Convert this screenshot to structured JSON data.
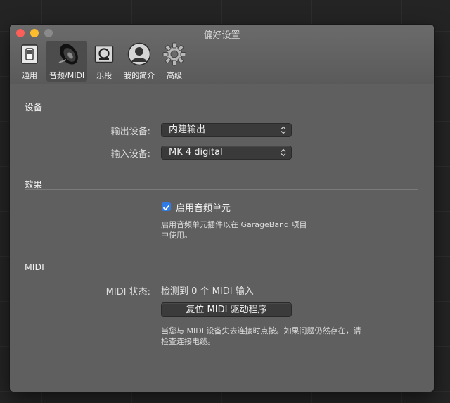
{
  "window": {
    "title": "偏好设置"
  },
  "toolbar": {
    "items": [
      {
        "label": "通用",
        "icon": "switch-icon"
      },
      {
        "label": "音频/MIDI",
        "icon": "speaker-icon",
        "selected": true
      },
      {
        "label": "乐段",
        "icon": "loop-icon"
      },
      {
        "label": "我的简介",
        "icon": "profile-icon"
      },
      {
        "label": "高级",
        "icon": "gear-icon"
      }
    ]
  },
  "devices": {
    "section_title": "设备",
    "output_label": "输出设备:",
    "output_value": "内建输出",
    "input_label": "输入设备:",
    "input_value": "MK 4 digital"
  },
  "effects": {
    "section_title": "效果",
    "audio_units_label": "启用音频单元",
    "audio_units_checked": true,
    "help_line1": "启用音频单元插件以在 GarageBand 项目",
    "help_line2": "中使用。"
  },
  "midi": {
    "section_title": "MIDI",
    "status_label": "MIDI 状态:",
    "status_value": "检测到 0 个 MIDI 输入",
    "reset_button": "复位 MIDI 驱动程序",
    "help_line1": "当您与 MIDI 设备失去连接时点按。如果问题仍然存在，请",
    "help_line2": "检查连接电缆。"
  },
  "colors": {
    "close": "#fc5f57",
    "minimize": "#fdbc2e",
    "checkbox_accent": "#2f7ce8",
    "window_bg": "#5f5f5f"
  }
}
